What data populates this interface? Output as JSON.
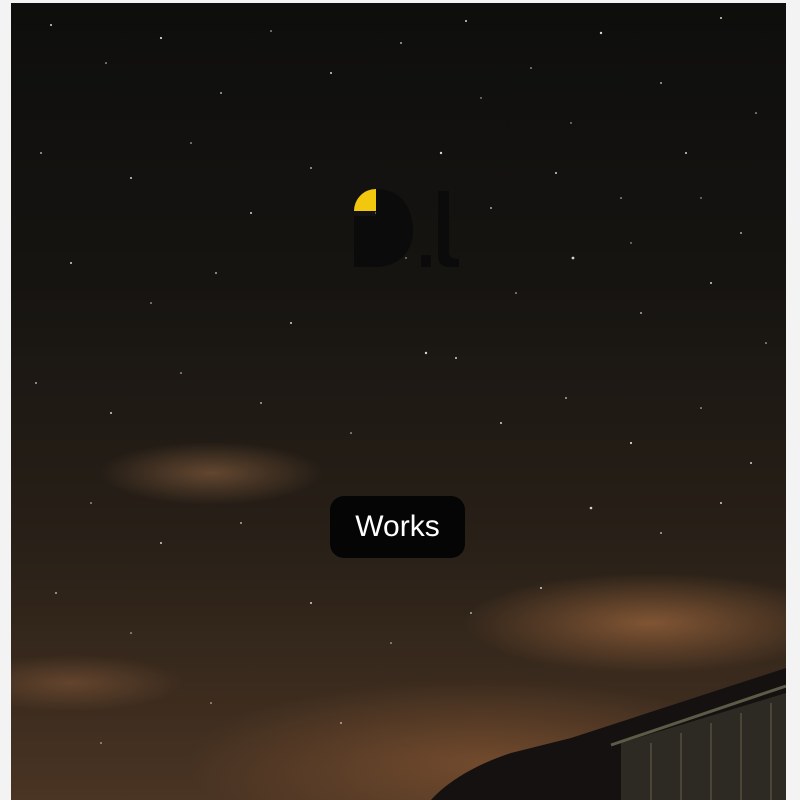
{
  "hero": {
    "button_label": "Works"
  },
  "logo": {
    "icon": "brand-logo-icon",
    "accent_color": "#f2c80f",
    "mark_color": "#0b0b0b"
  },
  "background": {
    "icon": "night-sky-photo"
  }
}
